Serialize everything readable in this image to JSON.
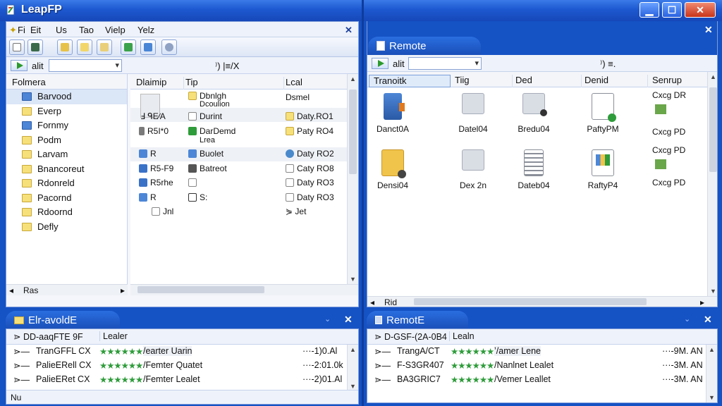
{
  "app": {
    "title": "LeapFP",
    "min": "▁",
    "max": "☐",
    "close": "✕"
  },
  "local": {
    "menu": [
      "Fi",
      "Eit",
      "Us",
      "Tao",
      "Vielp",
      "Yelz"
    ],
    "close": "✕",
    "address": {
      "label": "alit",
      "extra": "⁾) |≡/X"
    },
    "tree_header": "Folmera",
    "tree": [
      {
        "label": "Barvood",
        "icon": "blue-folder-icon",
        "selected": true
      },
      {
        "label": "Everp",
        "icon": "folder-icon"
      },
      {
        "label": "Fornmy",
        "icon": "blue-folder-icon"
      },
      {
        "label": "Podm",
        "icon": "folder-icon"
      },
      {
        "label": "Larvam",
        "icon": "folder-icon"
      },
      {
        "label": "Bnancoreut",
        "icon": "folder-icon"
      },
      {
        "label": "Rdonreld",
        "icon": "folder-icon"
      },
      {
        "label": "Pacornd",
        "icon": "folder-icon"
      },
      {
        "label": "Rdoornd",
        "icon": "folder-icon"
      },
      {
        "label": "Defly",
        "icon": "folder-icon"
      }
    ],
    "columns": [
      "Dlaimip",
      "Tip",
      "Lcal"
    ],
    "rows": [
      {
        "c1": "",
        "c2a": "Dbnlgh",
        "c2b": "Dcoulion",
        "c3": "Dsmel"
      },
      {
        "c1": "Ⅎ ᑫΕ∕Α",
        "c2a": "Durint",
        "c3": "Daty.RO1"
      },
      {
        "c1": "R5I*0",
        "c2a": "DarDemd",
        "c2b": "Lrea",
        "c3": "Paty RO4"
      },
      {
        "c1": "R",
        "c2a": "Buolet",
        "c3": "Daty RO2"
      },
      {
        "c1": "R5-F9",
        "c2a": "Batreot",
        "c3": "Caty RO8"
      },
      {
        "c1": "R5rhe",
        "c2a": "",
        "c3": "Daty RO3"
      },
      {
        "c1": "R",
        "c2a": "S:",
        "c3": "Daty RO3"
      },
      {
        "c1": "Jnl",
        "c2a": "",
        "c3": "Jet"
      }
    ],
    "hscroll_label": "Ras"
  },
  "remote": {
    "tab": "Remote",
    "close": "✕",
    "address": {
      "label": "alit",
      "extra": "⁾) ≡."
    },
    "columns": [
      "Tranoitk",
      "Tiig",
      "Ded",
      "Denid",
      "Senrup"
    ],
    "icons": [
      {
        "label": "Danct0A",
        "icon": "blue-doc-icon"
      },
      {
        "label": "Datel04",
        "icon": "folder-icon"
      },
      {
        "label": "Bredu04",
        "icon": "folder-search-icon"
      },
      {
        "label": "PaftyPM",
        "icon": "doc-check-icon"
      },
      {
        "label": "Densi04",
        "icon": "yellow-folder-icon"
      },
      {
        "label": "Dex 2n",
        "icon": "folder-icon"
      },
      {
        "label": "Dateb04",
        "icon": "text-doc-icon"
      },
      {
        "label": "RaftyP4",
        "icon": "image-doc-icon"
      }
    ],
    "side": [
      "Cxcg DR",
      "Cxcg PD",
      "Cxcg PD",
      "Cxcg PD"
    ],
    "hscroll_label": "Rid"
  },
  "queue_local": {
    "tab": "Elr-avoldE",
    "close": "✕",
    "header": [
      "DD-aaqFTE 9F",
      "Lealer"
    ],
    "rows": [
      {
        "name": "TranGFFL CX",
        "desc": "/earter Uarin",
        "time": "···-1)0.Al"
      },
      {
        "name": "PalieERell CX",
        "desc": "/Femter Quatet",
        "time": "···-2:01.0k"
      },
      {
        "name": "PalieERet CX",
        "desc": "/Femter Lealet",
        "time": "···-2)01.Al"
      }
    ],
    "stars": [
      "★★★★★★",
      "★★★★★★",
      "★★★★★★"
    ],
    "status": "Nu"
  },
  "queue_remote": {
    "tab": "RemotE",
    "close": "✕",
    "header": [
      "D-GSF-(2A-0B4",
      "Lealn"
    ],
    "rows": [
      {
        "name": "TrangA/CT",
        "desc": "ʼ/amer Lene",
        "time": "···-9M. AN"
      },
      {
        "name": "F-S3GR407",
        "desc": "/Nanlnet Lealet",
        "time": "···-3M. AN"
      },
      {
        "name": "BA3GRIC7",
        "desc": "/Vemer Leallet",
        "time": "···-3M. AN"
      }
    ],
    "stars": [
      "★★★★★★",
      "★★★★★★",
      "★★★★★★"
    ]
  },
  "colors": {
    "accent": "#1d58d0",
    "selection": "#dbe6f7",
    "folder": "#f6e07a"
  }
}
